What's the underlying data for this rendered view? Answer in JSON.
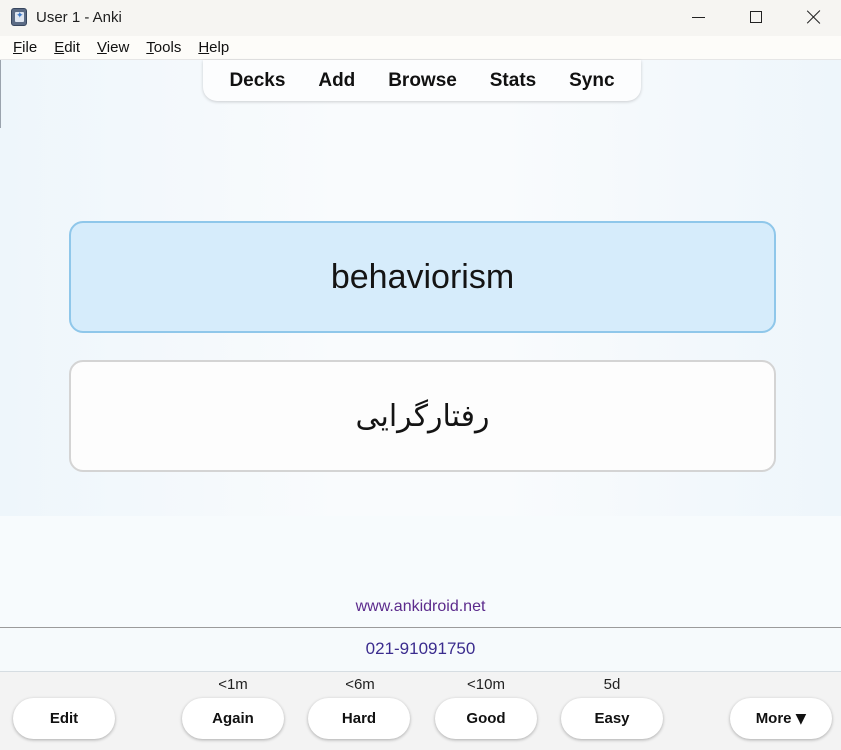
{
  "window": {
    "title": "User 1 - Anki"
  },
  "menu": {
    "items": [
      {
        "first": "F",
        "rest": "ile"
      },
      {
        "first": "E",
        "rest": "dit"
      },
      {
        "first": "V",
        "rest": "iew"
      },
      {
        "first": "T",
        "rest": "ools"
      },
      {
        "first": "H",
        "rest": "elp"
      }
    ]
  },
  "toolbar": {
    "links": [
      "Decks",
      "Add",
      "Browse",
      "Stats",
      "Sync"
    ]
  },
  "card": {
    "front": "behaviorism",
    "back": "رفتارگرایی"
  },
  "footer": {
    "website": "www.ankidroid.net",
    "phone": "021-91091750"
  },
  "answer_bar": {
    "edit_label": "Edit",
    "buttons": [
      {
        "label": "Again",
        "interval": "<1m"
      },
      {
        "label": "Hard",
        "interval": "<6m"
      },
      {
        "label": "Good",
        "interval": "<10m"
      },
      {
        "label": "Easy",
        "interval": "5d"
      }
    ],
    "more_label": "More",
    "more_arrow": "▼"
  },
  "icons": {
    "app": "anki-app-icon",
    "minimize": "minimize-icon",
    "maximize": "maximize-icon",
    "close": "close-icon"
  }
}
